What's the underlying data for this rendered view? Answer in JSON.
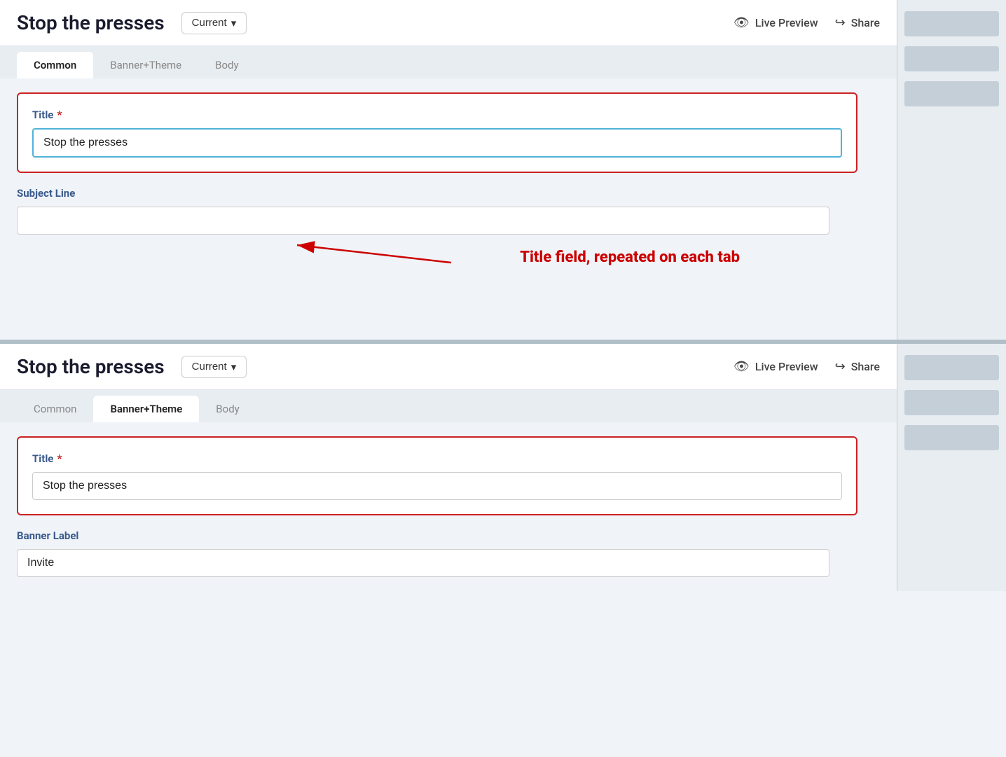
{
  "page": {
    "title": "Stop the presses"
  },
  "header": {
    "title": "Stop the presses",
    "dropdown_label": "Current",
    "dropdown_icon": "▾",
    "live_preview_label": "Live Preview",
    "share_label": "Share"
  },
  "tabs_top": {
    "items": [
      {
        "id": "common",
        "label": "Common",
        "active": true
      },
      {
        "id": "banner-theme",
        "label": "Banner+Theme",
        "active": false
      },
      {
        "id": "body",
        "label": "Body",
        "active": false
      }
    ]
  },
  "tabs_bottom": {
    "items": [
      {
        "id": "common2",
        "label": "Common",
        "active": false
      },
      {
        "id": "banner-theme2",
        "label": "Banner+Theme",
        "active": true
      },
      {
        "id": "body2",
        "label": "Body",
        "active": false
      }
    ]
  },
  "form_top": {
    "title_label": "Title",
    "title_required": "*",
    "title_value": "Stop the presses",
    "title_placeholder": "",
    "subject_label": "Subject Line",
    "subject_value": "",
    "subject_placeholder": ""
  },
  "form_bottom": {
    "title_label": "Title",
    "title_required": "*",
    "title_value": "Stop the presses",
    "title_placeholder": "",
    "banner_label": "Banner Label",
    "banner_value": "Invite",
    "banner_placeholder": ""
  },
  "annotation": {
    "text": "Title field, repeated on each tab"
  },
  "right_panel_top": {
    "blocks": [
      "",
      "",
      ""
    ]
  },
  "right_panel_bottom": {
    "blocks": [
      "",
      "",
      ""
    ]
  }
}
